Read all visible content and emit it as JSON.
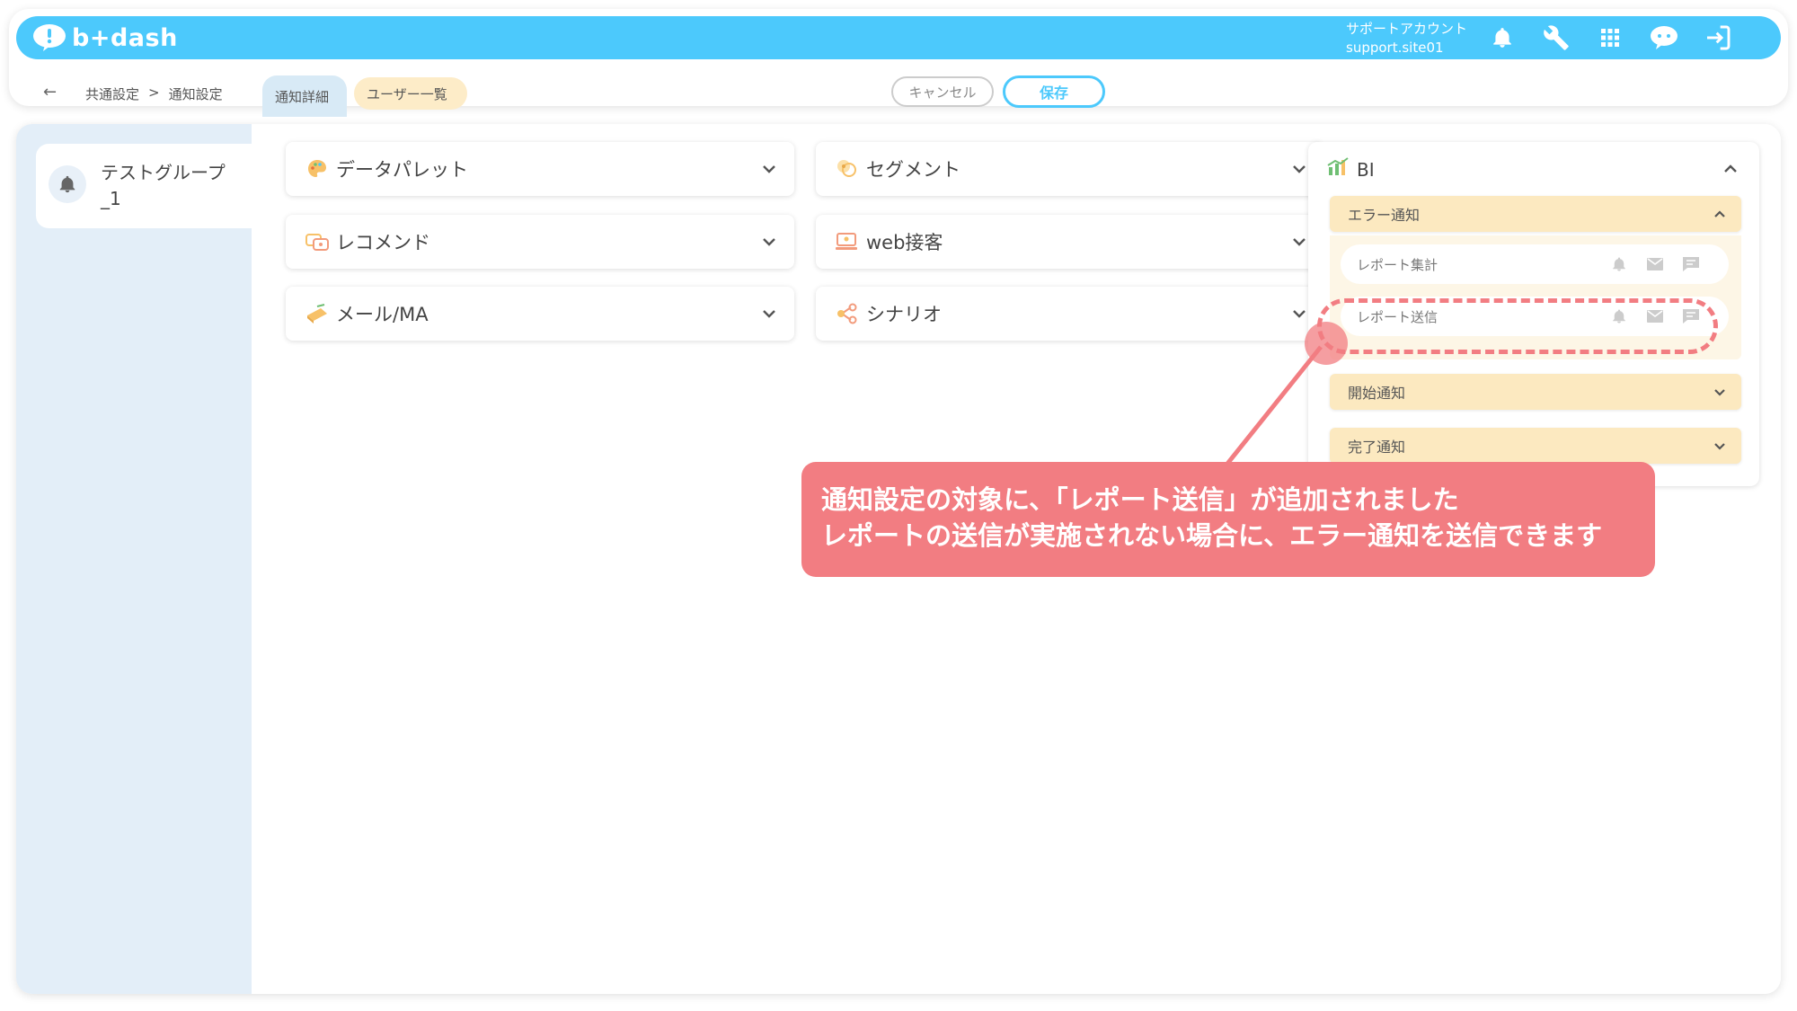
{
  "header": {
    "logo_text": "b+dash",
    "account_label": "サポートアカウント",
    "account_id": "support.site01",
    "icons": [
      "bell-icon",
      "wrench-icon",
      "grid-icon",
      "support-chat-icon",
      "logout-icon"
    ]
  },
  "subbar": {
    "breadcrumb": [
      "共通設定",
      ">",
      "通知設定"
    ],
    "tabs": [
      {
        "label": "通知詳細"
      },
      {
        "label": "ユーザー一覧"
      }
    ],
    "cancel_label": "キャンセル",
    "save_label": "保存"
  },
  "sidebar": {
    "group_name": "テストグループ_1"
  },
  "cards": [
    {
      "label": "データパレット",
      "icon": "palette-icon"
    },
    {
      "label": "セグメント",
      "icon": "segment-icon"
    },
    {
      "label": "レコメンド",
      "icon": "recommend-icon"
    },
    {
      "label": "web接客",
      "icon": "web-service-icon"
    },
    {
      "label": "メール/MA",
      "icon": "mail-ma-icon"
    },
    {
      "label": "シナリオ",
      "icon": "scenario-icon"
    }
  ],
  "bi": {
    "title": "BI",
    "sections": [
      {
        "label": "エラー通知",
        "expanded": true,
        "items": [
          {
            "label": "レポート集計"
          },
          {
            "label": "レポート送信"
          }
        ]
      },
      {
        "label": "開始通知",
        "expanded": false
      },
      {
        "label": "完了通知",
        "expanded": false
      }
    ]
  },
  "callout": {
    "line1": "通知設定の対象に、「レポート送信」が追加されました",
    "line2": "レポートの送信が実施されない場合に、エラー通知を送信できます"
  },
  "colors": {
    "brand": "#4cc9fc",
    "accordion": "#fce9c0",
    "highlight": "#f27d82",
    "sidebar": "#e3eef8"
  }
}
